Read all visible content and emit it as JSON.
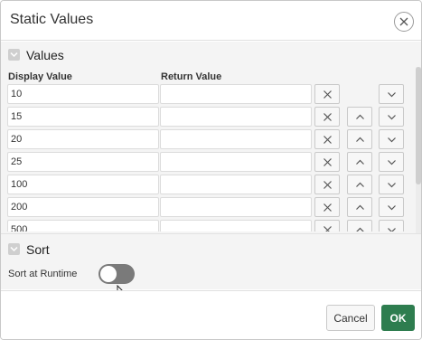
{
  "dialog": {
    "title": "Static Values"
  },
  "values_region": {
    "title": "Values",
    "col_display": "Display Value",
    "col_return": "Return Value",
    "rows": [
      {
        "display": "10",
        "return": ""
      },
      {
        "display": "15",
        "return": ""
      },
      {
        "display": "20",
        "return": ""
      },
      {
        "display": "25",
        "return": ""
      },
      {
        "display": "100",
        "return": ""
      },
      {
        "display": "200",
        "return": ""
      },
      {
        "display": "500",
        "return": ""
      }
    ]
  },
  "sort_region": {
    "title": "Sort",
    "runtime_label": "Sort at Runtime",
    "runtime_enabled": false
  },
  "footer": {
    "cancel_label": "Cancel",
    "ok_label": "OK"
  },
  "icons": {
    "close": "close-icon",
    "collapse": "chevron-down-icon",
    "delete": "x-icon",
    "move_up": "chevron-up-icon",
    "move_down": "chevron-down-icon",
    "cursor": "mouse-pointer-icon"
  },
  "colors": {
    "ok_button": "#2e7d4f",
    "toggle_off": "#7a7a7a"
  }
}
